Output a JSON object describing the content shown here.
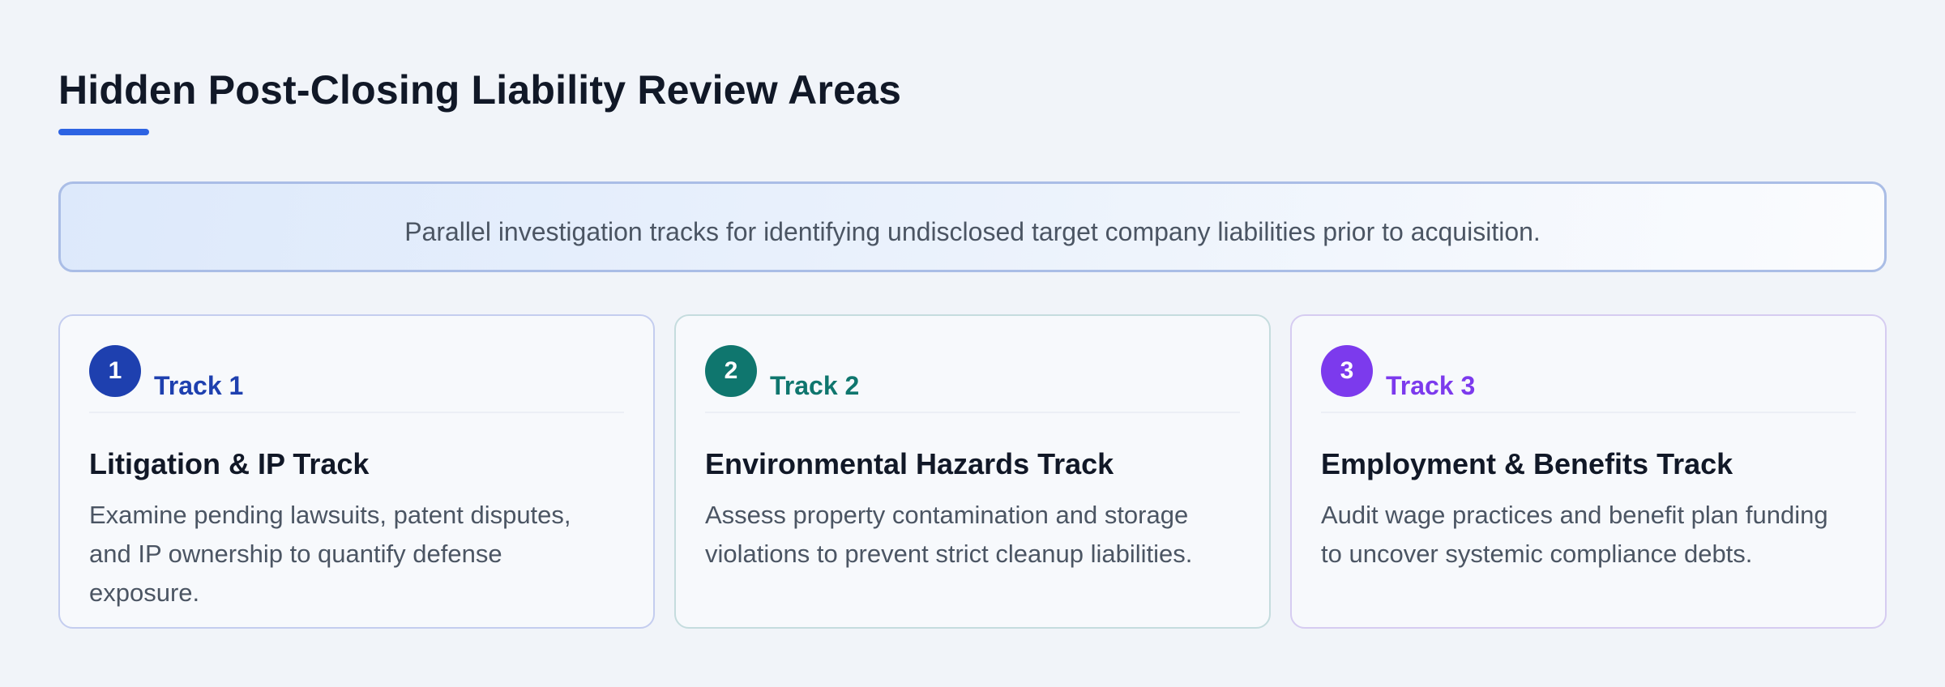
{
  "page": {
    "title": "Hidden Post-Closing Liability Review Areas",
    "accent_color": "#2d63e3"
  },
  "banner": {
    "text": "Parallel investigation tracks for identifying undisclosed target company liabilities prior to acquisition."
  },
  "tracks": [
    {
      "number": "1",
      "label": "Track 1",
      "title": "Litigation & IP Track",
      "description": "Examine pending lawsuits, patent disputes, and IP ownership to quantify defense exposure.",
      "color": "#1e40af"
    },
    {
      "number": "2",
      "label": "Track 2",
      "title": "Environmental Hazards Track",
      "description": "Assess property contamination and storage violations to prevent strict cleanup liabilities.",
      "color": "#0f766e"
    },
    {
      "number": "3",
      "label": "Track 3",
      "title": "Employment & Benefits Track",
      "description": "Audit wage practices and benefit plan funding to uncover systemic compliance debts.",
      "color": "#7c3aed"
    }
  ]
}
